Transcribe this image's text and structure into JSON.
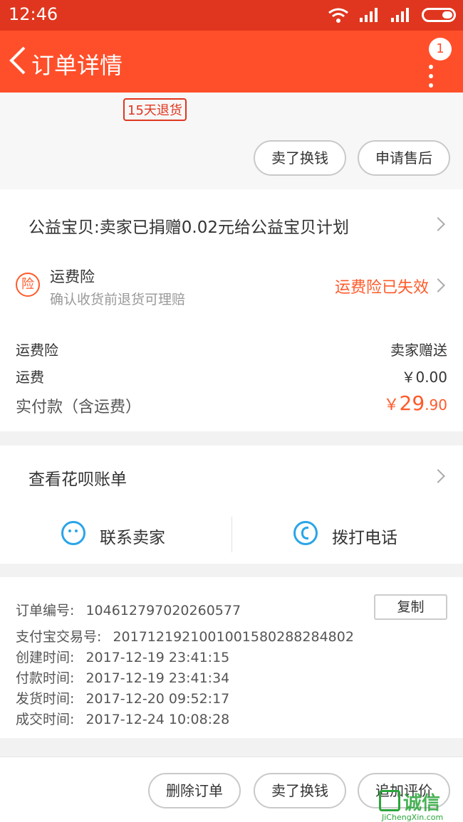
{
  "status_bar": {
    "time": "12:46"
  },
  "nav": {
    "title": "订单详情",
    "badge_count": "1"
  },
  "product_card": {
    "return_tag": "15天退货",
    "buttons": [
      "卖了换钱",
      "申请售后"
    ]
  },
  "summary": {
    "charity_text": "公益宝贝:卖家已捐赠0.02元给公益宝贝计划",
    "insurance": {
      "icon_text": "险",
      "title": "运费险",
      "subtitle": "确认收货前退货可理赔",
      "status": "运费险已失效"
    },
    "fees": [
      {
        "label": "运费险",
        "value": "卖家赠送"
      },
      {
        "label": "运费",
        "value": "￥0.00"
      }
    ],
    "total": {
      "label": "实付款（含运费）",
      "currency": "￥",
      "integer": "29",
      "decimal": ".90"
    }
  },
  "service": {
    "huabei_label": "查看花呗账单",
    "contact_seller": "联系卖家",
    "call_phone": "拨打电话"
  },
  "order_info": {
    "copy_button": "复制",
    "rows": [
      {
        "label": "订单编号:",
        "value": "104612797020260577"
      },
      {
        "label": "支付宝交易号:",
        "value": "2017121921001001580288284802"
      },
      {
        "label": "创建时间:",
        "value": "2017-12-19 23:41:15"
      },
      {
        "label": "付款时间:",
        "value": "2017-12-19 23:41:34"
      },
      {
        "label": "发货时间:",
        "value": "2017-12-20 09:52:17"
      },
      {
        "label": "成交时间:",
        "value": "2017-12-24 10:08:28"
      }
    ]
  },
  "bottom_bar": {
    "buttons": [
      "删除订单",
      "卖了换钱",
      "追加评价"
    ]
  },
  "watermark": {
    "text": "诚信",
    "sub": "JiChengXin.com"
  },
  "colors": {
    "status_bar": "#e0361f",
    "nav": "#ff4f2a",
    "accent_orange": "#ff5a2a",
    "blue": "#2aa5e7"
  }
}
